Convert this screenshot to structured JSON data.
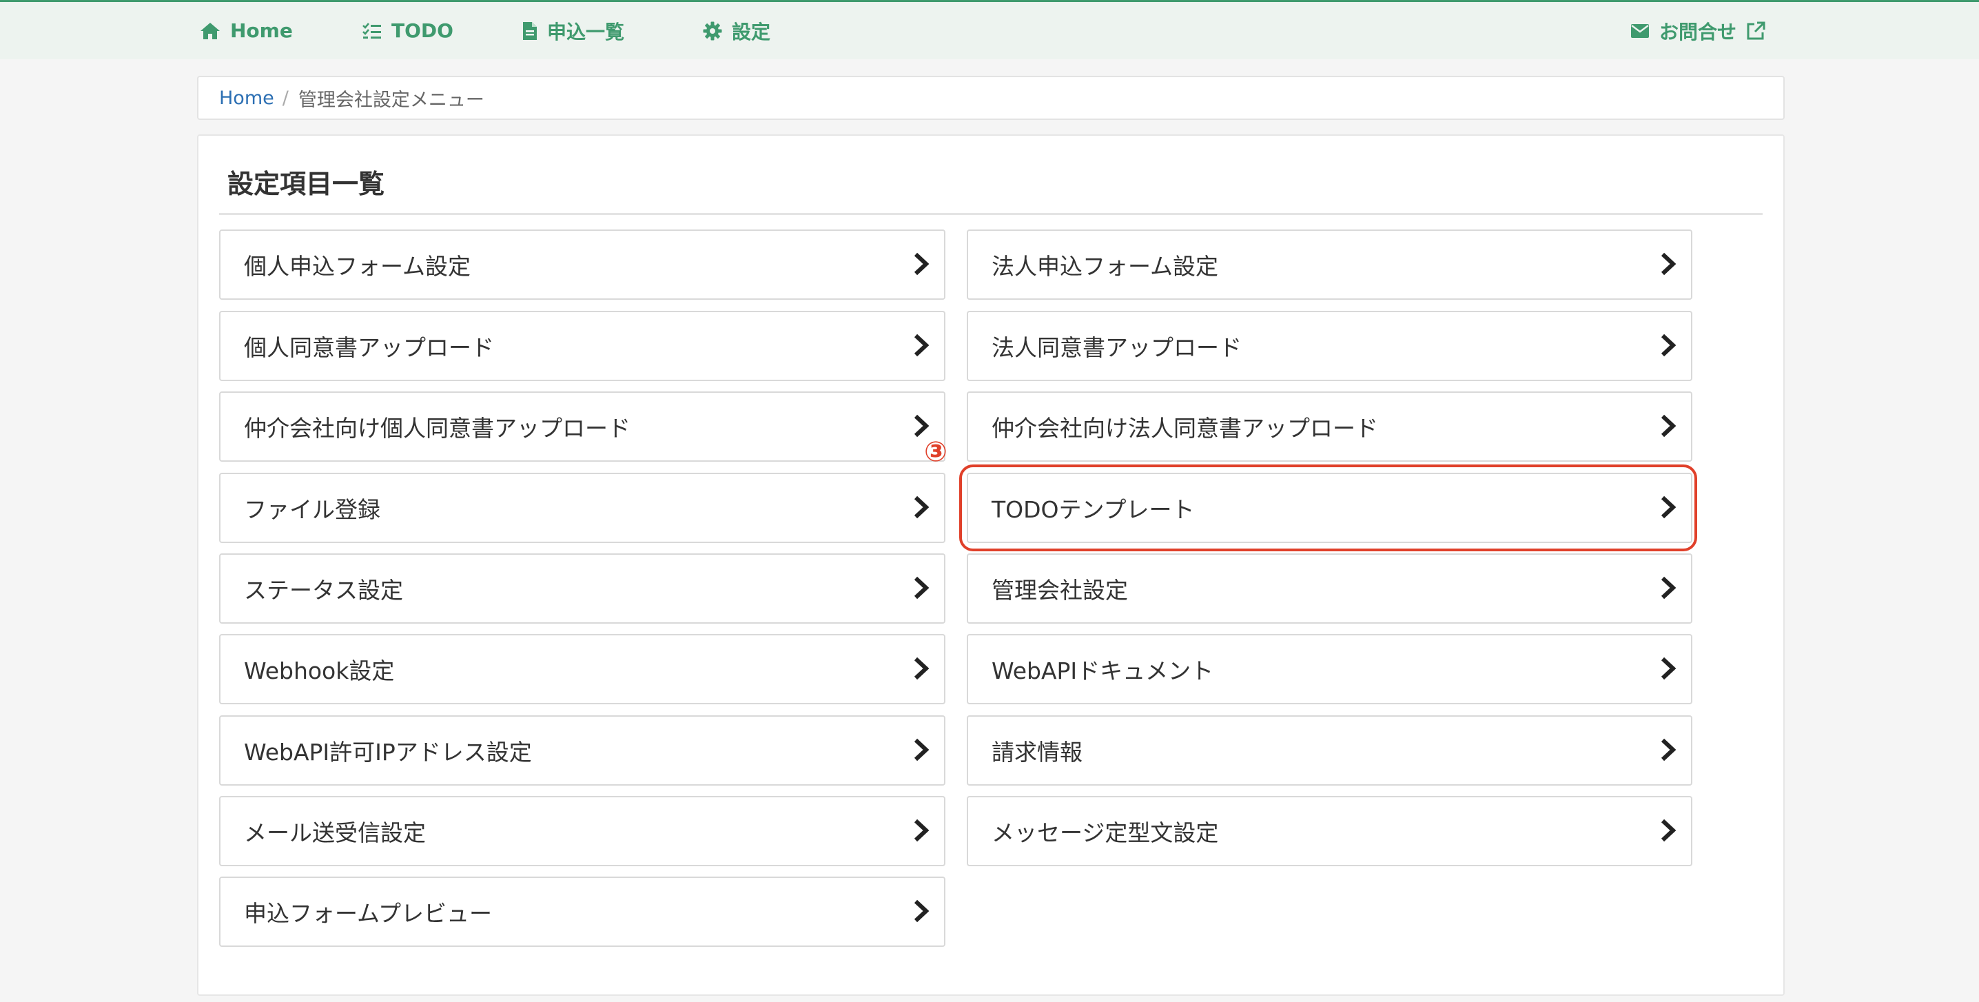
{
  "nav": {
    "home": "Home",
    "todo": "TODO",
    "applications": "申込一覧",
    "settings": "設定",
    "contact": "お問合せ"
  },
  "breadcrumb": {
    "home": "Home",
    "separator": "/",
    "current": "管理会社設定メニュー"
  },
  "panel": {
    "title": "設定項目一覧"
  },
  "menu": {
    "left": [
      "個人申込フォーム設定",
      "個人同意書アップロード",
      "仲介会社向け個人同意書アップロード",
      "ファイル登録",
      "ステータス設定",
      "Webhook設定",
      "WebAPI許可IPアドレス設定",
      "メール送受信設定",
      "申込フォームプレビュー"
    ],
    "right": [
      "法人申込フォーム設定",
      "法人同意書アップロード",
      "仲介会社向け法人同意書アップロード",
      "TODOテンプレート",
      "管理会社設定",
      "WebAPIドキュメント",
      "請求情報",
      "メッセージ定型文設定"
    ]
  },
  "annotation": {
    "marker": "③",
    "color": "#e0402a"
  },
  "colors": {
    "accent": "#3f9a6e",
    "link": "#2c6fb3"
  }
}
